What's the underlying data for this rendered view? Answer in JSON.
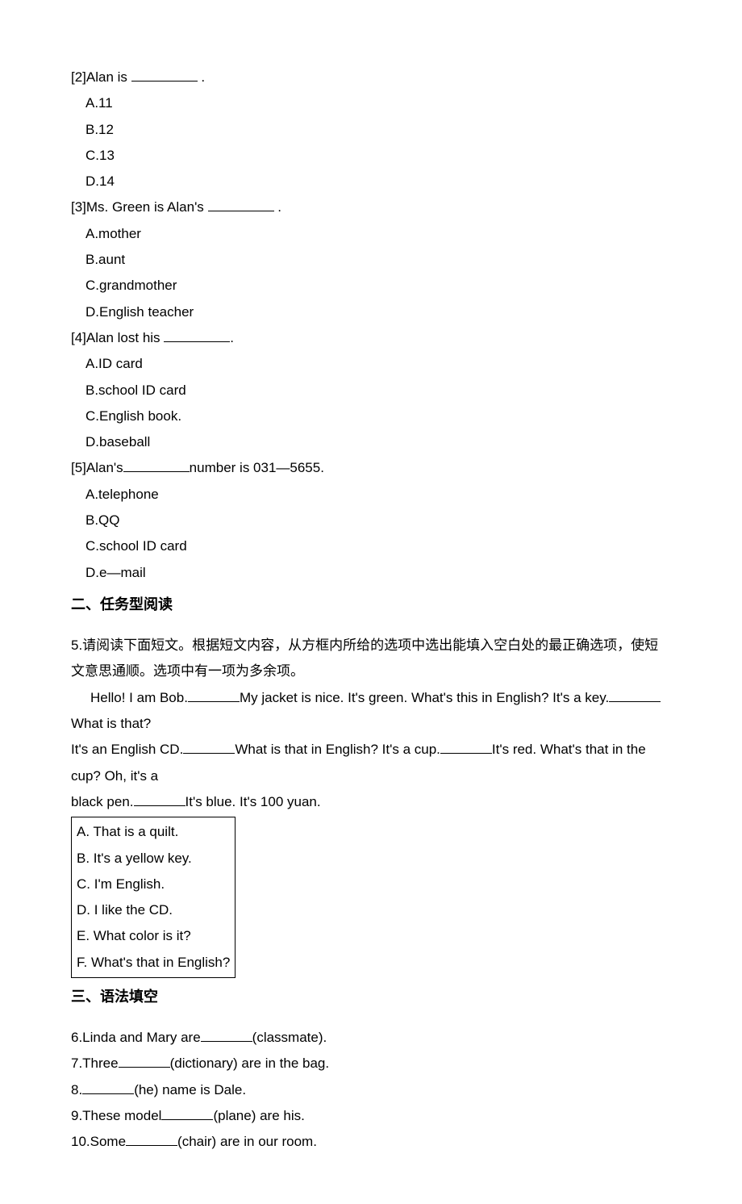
{
  "q2": {
    "stem_pre": "[2]Alan is",
    "stem_post": ".",
    "opts": {
      "a": "A.11",
      "b": "B.12",
      "c": "C.13",
      "d": "D.14"
    }
  },
  "q3": {
    "stem_pre": "[3]Ms. Green is Alan's",
    "stem_post": ".",
    "opts": {
      "a": "A.mother",
      "b": "B.aunt",
      "c": "C.grandmother",
      "d": "D.English teacher"
    }
  },
  "q4": {
    "stem_pre": "[4]Alan lost his ",
    "stem_post": ".",
    "opts": {
      "a": "A.ID card",
      "b": "B.school ID card",
      "c": "C.English book.",
      "d": "D.baseball"
    }
  },
  "q5": {
    "stem_pre": "[5]Alan's",
    "stem_post": "number is 031—5655.",
    "opts": {
      "a": "A.telephone",
      "b": "B.QQ",
      "c": "C.school ID card",
      "d": "D.e—mail"
    }
  },
  "section2": {
    "heading": "二、任务型阅读",
    "instructions": "5.请阅读下面短文。根据短文内容，从方框内所给的选项中选出能填入空白处的最正确选项，使短文意思通顺。选项中有一项为多余项。",
    "passage": {
      "p1_a": "Hello! I am Bob.",
      "p1_b": "My jacket is nice. It's green. What's this in English? It's a key.",
      "p1_c": "What is that?",
      "p2_a": "It's an English CD.",
      "p2_b": "What is that in English? It's a cup.",
      "p2_c": "It's red. What's that in the cup? Oh, it's a",
      "p3_a": "black pen.",
      "p3_b": "It's blue. It's 100 yuan."
    },
    "options": {
      "a": "A. That is a quilt.",
      "b": "B. It's a yellow key.",
      "c": "C. I'm English.",
      "d": "D. I like the CD.",
      "e": "E. What color is it?",
      "f": "F. What's that in English?"
    }
  },
  "section3": {
    "heading": "三、语法填空",
    "items": {
      "i6_a": "6.Linda and Mary are",
      "i6_b": "(classmate).",
      "i7_a": "7.Three",
      "i7_b": "(dictionary) are in the bag.",
      "i8_a": "8.",
      "i8_b": "(he) name is Dale.",
      "i9_a": "9.These model",
      "i9_b": "(plane) are his.",
      "i10_a": "10.Some",
      "i10_b": "(chair) are in our room."
    }
  }
}
